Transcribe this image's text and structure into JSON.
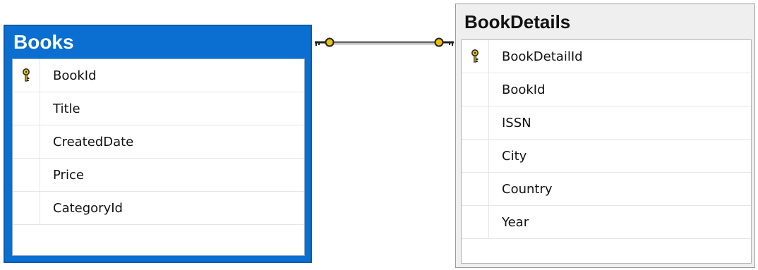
{
  "tables": [
    {
      "title": "Books",
      "columns": [
        {
          "name": "BookId",
          "primary_key": true,
          "icon": "key-icon"
        },
        {
          "name": "Title",
          "primary_key": false
        },
        {
          "name": "CreatedDate",
          "primary_key": false
        },
        {
          "name": "Price",
          "primary_key": false
        },
        {
          "name": "CategoryId",
          "primary_key": false
        }
      ]
    },
    {
      "title": "BookDetails",
      "columns": [
        {
          "name": "BookDetailId",
          "primary_key": true,
          "icon": "key-icon"
        },
        {
          "name": "BookId",
          "primary_key": false
        },
        {
          "name": "ISSN",
          "primary_key": false
        },
        {
          "name": "City",
          "primary_key": false
        },
        {
          "name": "Country",
          "primary_key": false
        },
        {
          "name": "Year",
          "primary_key": false
        }
      ]
    }
  ],
  "relationship": {
    "from_table": "Books",
    "to_table": "BookDetails",
    "type": "one-to-one",
    "end_icons": [
      "key-icon",
      "key-icon"
    ]
  },
  "colors": {
    "selected_header": "#0a6fd0",
    "key_gold": "#e8c20a",
    "connector": "#6b6b6b"
  }
}
